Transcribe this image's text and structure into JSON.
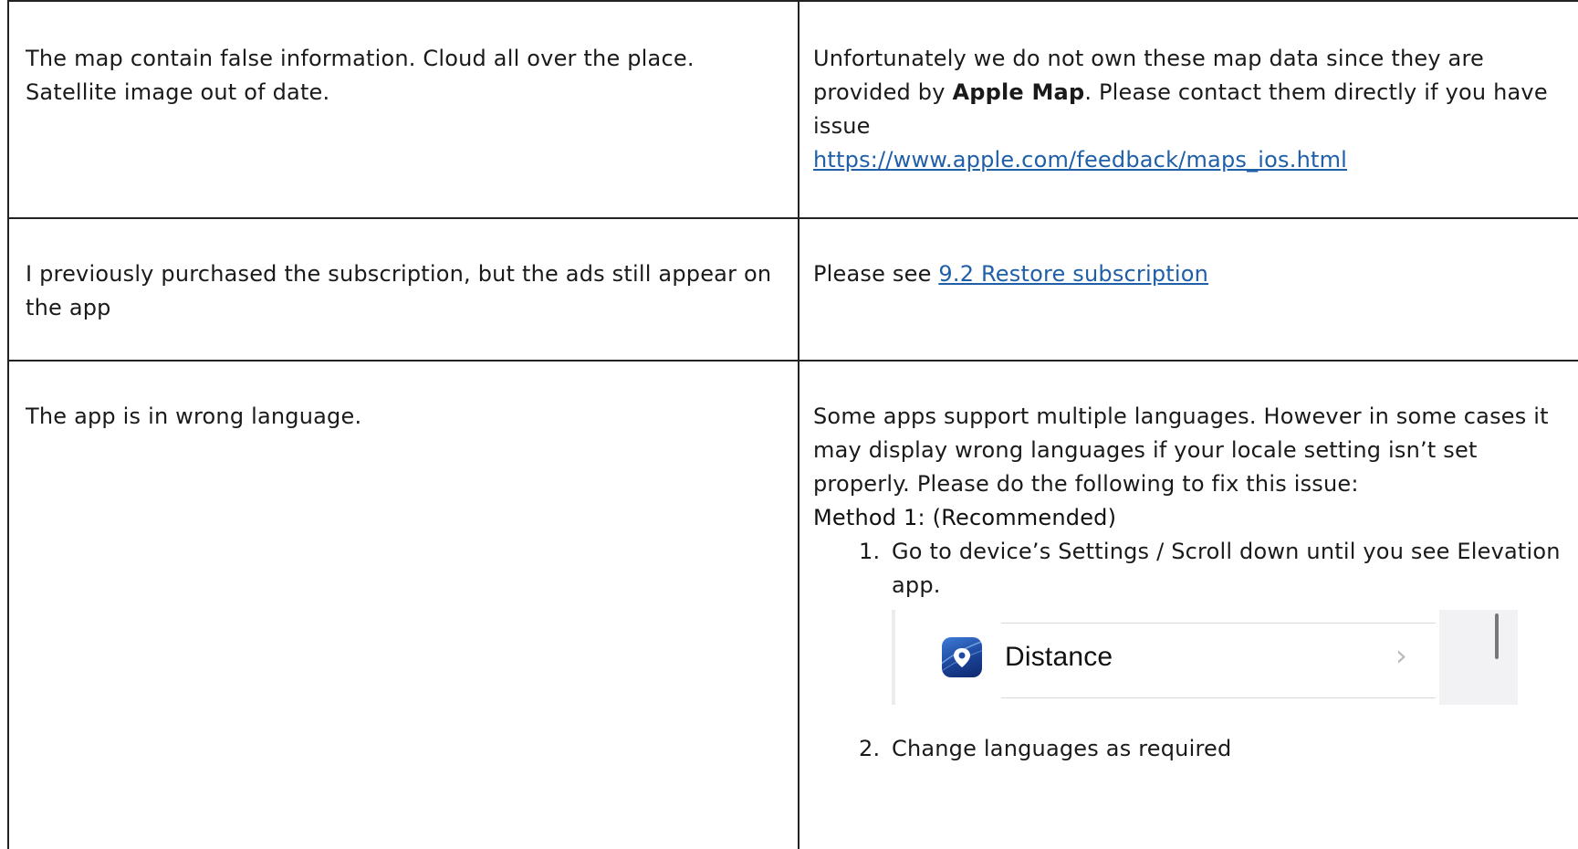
{
  "rows": [
    {
      "question": "The map contain false information. Cloud all over the place. Satellite image out of date.",
      "answer": {
        "text_before": "Unfortunately we do not own these map data since they are provided by ",
        "bold": "Apple Map",
        "text_after": ". Please contact them directly if you have issue",
        "link": "https://www.apple.com/feedback/maps_ios.html"
      }
    },
    {
      "question": "I previously purchased the subscription, but the ads still appear on the app",
      "answer": {
        "prefix": "Please see ",
        "link": "9.2 Restore subscription"
      }
    },
    {
      "question": "The app is in wrong language.",
      "answer": {
        "intro": "Some apps support multiple languages. However in some cases it may display wrong languages if your locale setting isn’t set properly. Please do the following to fix this issue:",
        "method_heading": "Method 1: (Recommended)",
        "steps": [
          {
            "number": "1.",
            "text": "Go to device’s Settings / Scroll down until you see Elevation app."
          },
          {
            "number": "2.",
            "text": "Change languages as required"
          }
        ],
        "settings_row": {
          "app_name": "Distance",
          "icon": "app-icon-map-pin",
          "chevron": "›"
        }
      }
    }
  ],
  "colors": {
    "border": "#222222",
    "link": "#1f5fa8"
  }
}
